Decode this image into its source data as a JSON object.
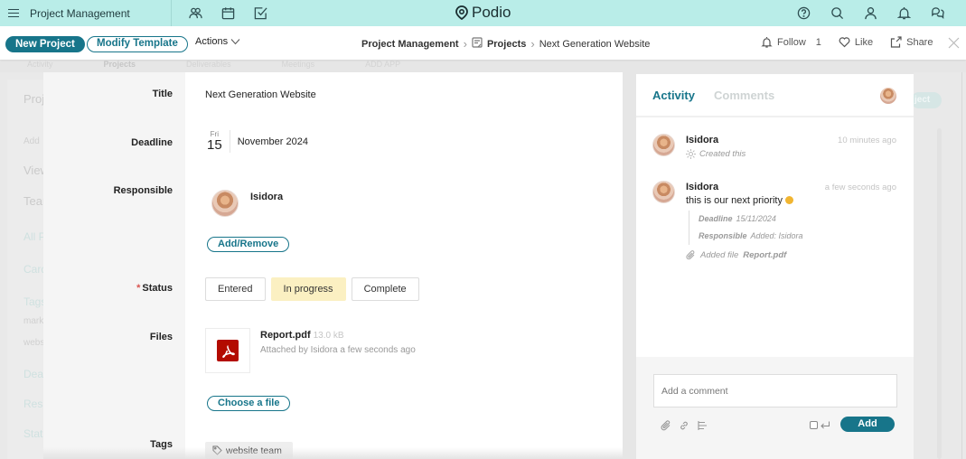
{
  "topbar": {
    "workspace_title": "Project Management",
    "brand": "Podio",
    "left_icons": [
      "contacts-icon",
      "calendar-icon",
      "tasks-icon"
    ],
    "right_icons": [
      "help-icon",
      "search-icon",
      "profile-icon",
      "notifications-icon",
      "chat-icon"
    ]
  },
  "subbar": {
    "new_project": "New Project",
    "modify_template": "Modify Template",
    "actions": "Actions",
    "breadcrumb": {
      "workspace": "Project Management",
      "app": "Projects",
      "item": "Next Generation Website"
    },
    "follow_label": "Follow",
    "follow_count": "1",
    "like_label": "Like",
    "share_label": "Share"
  },
  "background": {
    "tabs": [
      "Activity",
      "Projects",
      "Deliverables",
      "Meetings",
      "ADD APP"
    ],
    "left_fragments": [
      "Proj",
      "Add",
      "View",
      "Team",
      "All P",
      "Card",
      "Tags",
      "mark",
      "webs",
      "Dead",
      "Resp",
      "Stat"
    ],
    "right_pill": "ject"
  },
  "item": {
    "labels": {
      "title": "Title",
      "deadline": "Deadline",
      "responsible": "Responsible",
      "status": "Status",
      "status_required_marker": "*",
      "files": "Files",
      "tags": "Tags"
    },
    "title": "Next Generation Website",
    "deadline": {
      "weekday": "Fri",
      "day": "15",
      "month_year": "November 2024"
    },
    "responsible": {
      "name": "Isidora",
      "add_remove": "Add/Remove"
    },
    "status": {
      "options": [
        "Entered",
        "In progress",
        "Complete"
      ],
      "selected": "In progress"
    },
    "files": [
      {
        "name": "Report.pdf",
        "size": "13.0 kB",
        "meta": "Attached by Isidora a few seconds ago"
      }
    ],
    "choose_file": "Choose a file",
    "tags": [
      "website team"
    ]
  },
  "activity": {
    "tabs": [
      "Activity",
      "Comments"
    ],
    "active_tab": "Activity",
    "entries": [
      {
        "author": "Isidora",
        "time": "10 minutes ago",
        "sub": "Created this"
      },
      {
        "author": "Isidora",
        "time": "a few seconds ago",
        "text": "this is our next priority",
        "changes": [
          {
            "field": "Deadline",
            "value": "15/11/2024"
          },
          {
            "field": "Responsible",
            "value": "Added: Isidora"
          }
        ],
        "file_added_prefix": "Added file",
        "file_added_name": "Report.pdf"
      }
    ],
    "comment_placeholder": "Add a comment",
    "add_button": "Add"
  },
  "colors": {
    "topbar_bg": "#b9ede8",
    "accent": "#17758a",
    "status_selected_bg": "#fbf0c2",
    "pdf_red": "#b30b00"
  }
}
